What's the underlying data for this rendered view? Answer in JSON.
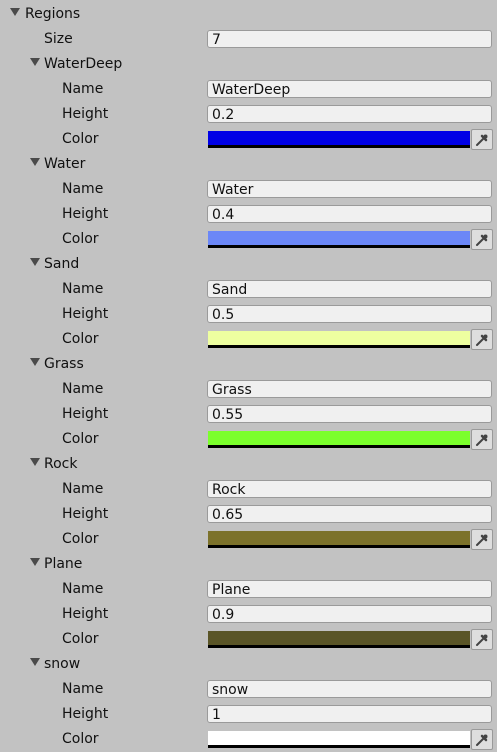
{
  "inspector": {
    "root_label": "Regions",
    "size_label": "Size",
    "size_value": "7",
    "field_labels": {
      "name": "Name",
      "height": "Height",
      "color": "Color"
    },
    "regions": [
      {
        "title": "WaterDeep",
        "name": "WaterDeep",
        "height": "0.2",
        "color": "#0000e6"
      },
      {
        "title": "Water",
        "name": "Water",
        "height": "0.4",
        "color": "#6b87f7"
      },
      {
        "title": "Sand",
        "name": "Sand",
        "height": "0.5",
        "color": "#eeffa0"
      },
      {
        "title": "Grass",
        "name": "Grass",
        "height": "0.55",
        "color": "#7bff2c"
      },
      {
        "title": "Rock",
        "name": "Rock",
        "height": "0.65",
        "color": "#7c722b"
      },
      {
        "title": "Plane",
        "name": "Plane",
        "height": "0.9",
        "color": "#5a5527"
      },
      {
        "title": "snow",
        "name": "snow",
        "height": "1",
        "color": "#ffffff"
      }
    ],
    "icons": {
      "foldout": "triangle-down-icon",
      "picker": "eyedropper-icon"
    }
  }
}
